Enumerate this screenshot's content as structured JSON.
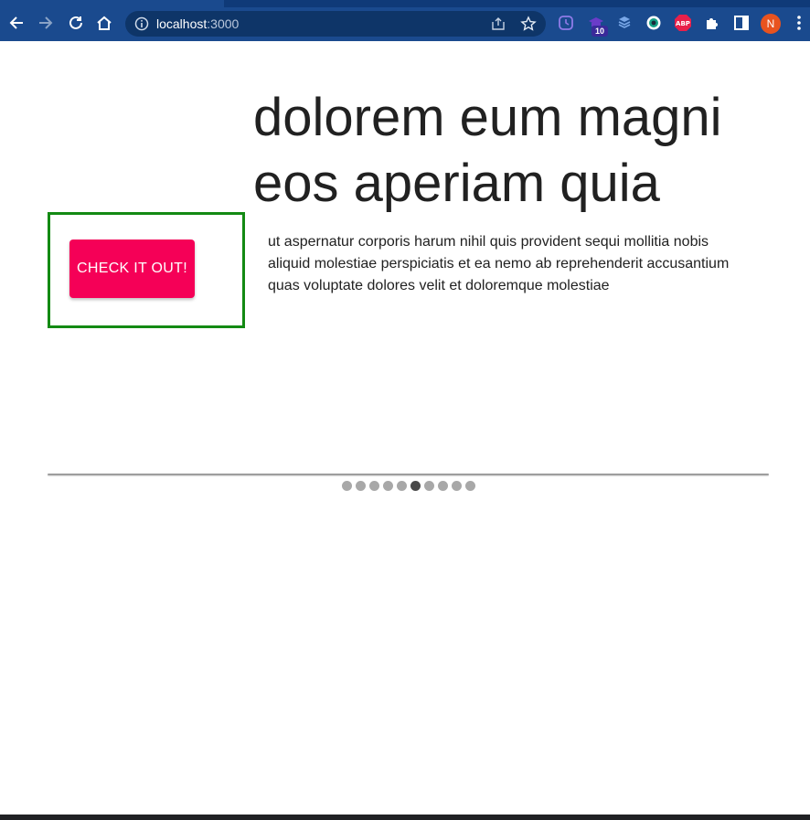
{
  "browser": {
    "url_host": "localhost",
    "url_port": ":3000",
    "extension_badge": "10",
    "profile_initial": "N",
    "colors": {
      "chrome": "#1a4a8e",
      "omnibox": "#0e3568"
    }
  },
  "hero": {
    "headline_line1": "dolorem eum magni",
    "headline_line2": "eos aperiam quia",
    "body": "ut aspernatur corporis harum nihil quis provident sequi mollitia nobis aliquid molestiae perspiciatis et ea nemo ab reprehenderit accusantium quas voluptate dolores velit et doloremque molestiae",
    "cta_label": "CHECK IT OUT!",
    "cta_color": "#f50057",
    "highlight_color": "#138a13"
  },
  "carousel": {
    "total_slides": 10,
    "active_index": 5
  }
}
